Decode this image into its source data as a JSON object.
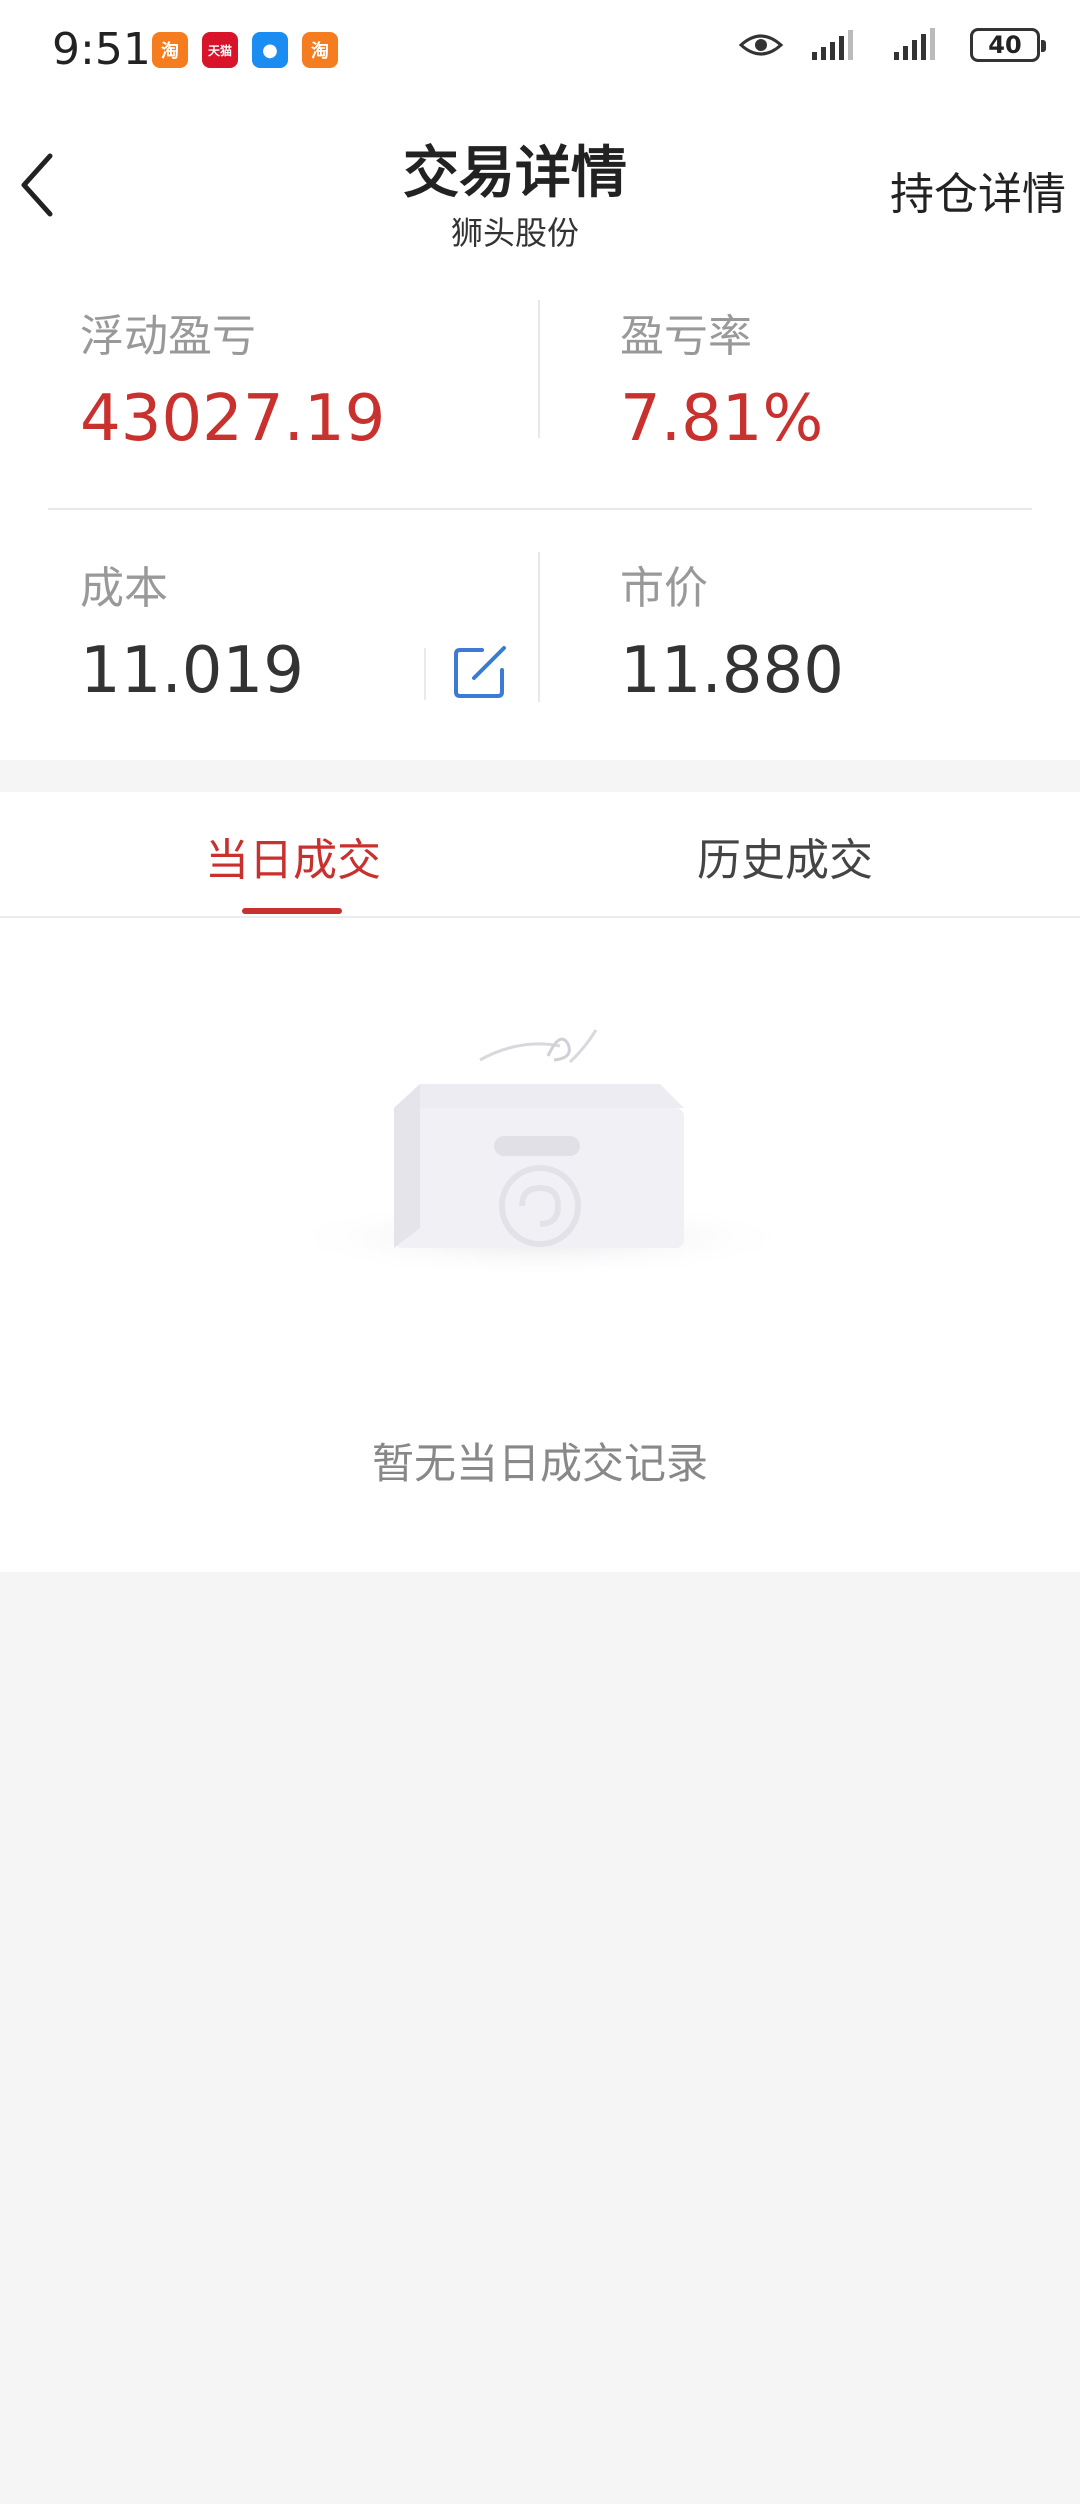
{
  "status_bar": {
    "time": "9:51",
    "apps": [
      {
        "name": "taobao-app-icon",
        "glyph": "淘"
      },
      {
        "name": "tmall-app-icon",
        "glyph": "天猫"
      },
      {
        "name": "message-app-icon",
        "glyph": "●"
      },
      {
        "name": "taobao-app-icon-2",
        "glyph": "淘"
      }
    ],
    "battery": "40"
  },
  "navbar": {
    "title": "交易详情",
    "subtitle": "狮头股份",
    "right_link": "持仓详情"
  },
  "summary": {
    "float_pl_label": "浮动盈亏",
    "float_pl_value": "43027.19",
    "pl_rate_label": "盈亏率",
    "pl_rate_value": "7.81%",
    "cost_label": "成本",
    "cost_value": "11.019",
    "price_label": "市价",
    "price_value": "11.880"
  },
  "tabs": [
    {
      "label": "当日成交",
      "active": true
    },
    {
      "label": "历史成交",
      "active": false
    }
  ],
  "empty_state": {
    "message": "暂无当日成交记录"
  },
  "colors": {
    "accent_red": "#c8312e",
    "edit_blue": "#3a7bd5",
    "background": "#f5f5f5"
  }
}
